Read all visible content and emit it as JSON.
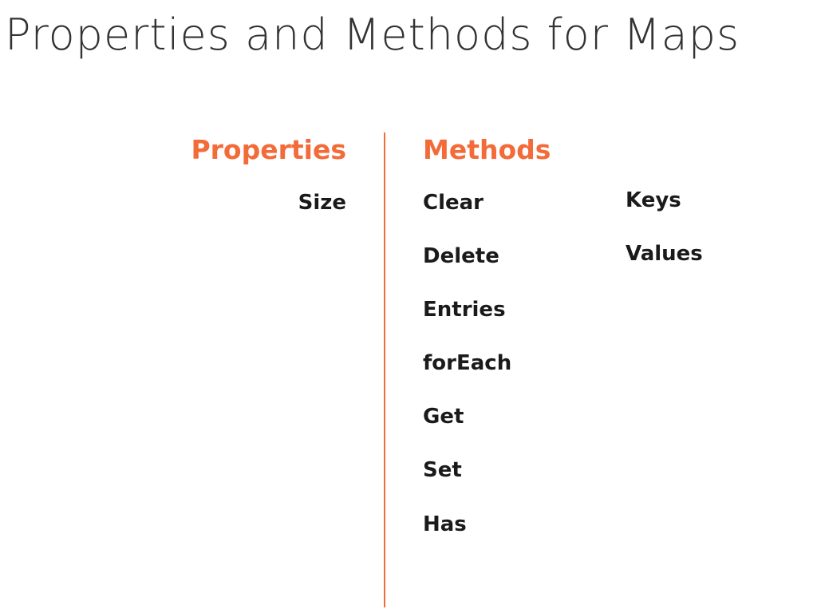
{
  "title": "Properties and Methods for Maps",
  "accent_color": "#f26b38",
  "properties": {
    "heading": "Properties",
    "items": [
      "Size"
    ]
  },
  "methods": {
    "heading": "Methods",
    "column1": [
      "Clear",
      "Delete",
      "Entries",
      "forEach",
      "Get",
      "Set",
      "Has"
    ],
    "column2": [
      "Keys",
      "Values"
    ]
  }
}
